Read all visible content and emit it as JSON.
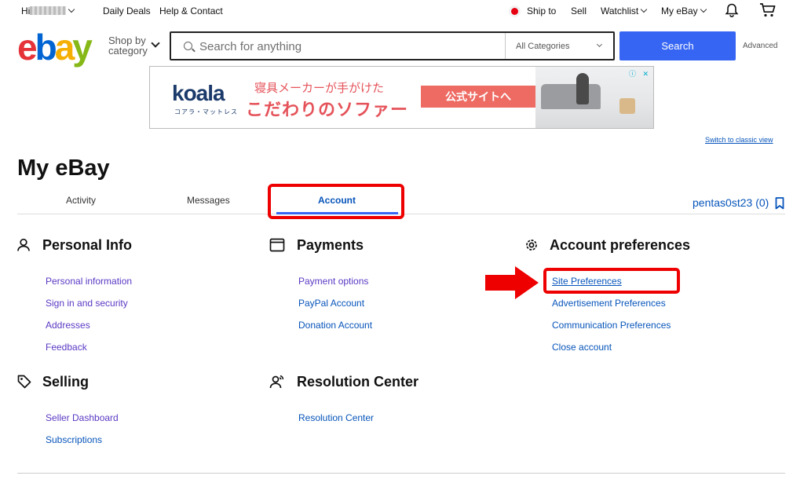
{
  "topbar": {
    "greeting": "Hi",
    "daily_deals": "Daily Deals",
    "help": "Help & Contact",
    "ship_to": "Ship to",
    "sell": "Sell",
    "watchlist": "Watchlist",
    "my_ebay": "My eBay"
  },
  "logo": {
    "e": "e",
    "b": "b",
    "a": "a",
    "y": "y"
  },
  "shop_by": {
    "line1": "Shop by",
    "line2": "category"
  },
  "search": {
    "placeholder": "Search for anything",
    "category": "All Categories",
    "button": "Search",
    "advanced": "Advanced"
  },
  "ad": {
    "brand": "koala",
    "brand_sub": "コアラ・マットレス",
    "line1": "寝具メーカーが手がけた",
    "line2": "こだわりのソファー",
    "cta": "公式サイトへ",
    "badge": "ⓘ ✕"
  },
  "switch_classic": "Switch to classic view",
  "page_title": "My eBay",
  "tabs": {
    "activity": "Activity",
    "messages": "Messages",
    "account": "Account"
  },
  "user": {
    "name": "pentas0st23",
    "count": "(0)"
  },
  "sections": {
    "personal": {
      "title": "Personal Info",
      "links": [
        "Personal information",
        "Sign in and security",
        "Addresses",
        "Feedback"
      ]
    },
    "payments": {
      "title": "Payments",
      "links": [
        "Payment options",
        "PayPal Account",
        "Donation Account"
      ]
    },
    "account_prefs": {
      "title": "Account preferences",
      "links": [
        "Site Preferences",
        "Advertisement Preferences",
        "Communication Preferences",
        "Close account"
      ]
    },
    "selling": {
      "title": "Selling",
      "links": [
        "Seller Dashboard",
        "Subscriptions"
      ]
    },
    "resolution": {
      "title": "Resolution Center",
      "links": [
        "Resolution Center"
      ]
    }
  },
  "colors": {
    "accent": "#3665f3",
    "link": "#0654ba",
    "visited": "#5a38c4",
    "highlight": "#e00000"
  }
}
